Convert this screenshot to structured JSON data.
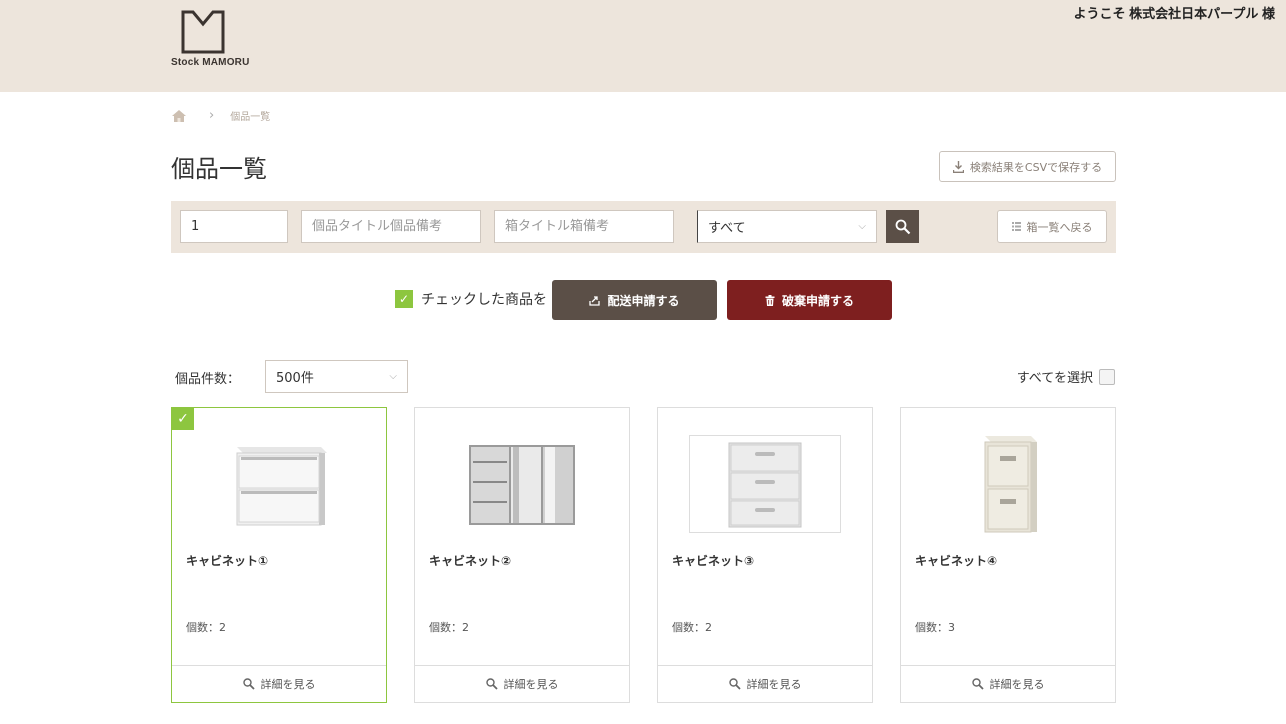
{
  "header": {
    "logo_text": "Stock MAMORU",
    "welcome": "ようこそ 株式会社日本パープル 様"
  },
  "breadcrumb": {
    "separator": "›",
    "current": "個品一覧"
  },
  "page": {
    "title": "個品一覧",
    "csv_button": "検索結果をCSVで保存する"
  },
  "search": {
    "box_number_value": "1",
    "item_placeholder": "個品タイトル個品備考",
    "box_placeholder": "箱タイトル箱備考",
    "category_selected": "すべて",
    "back_button": "箱一覧へ戻る"
  },
  "actions": {
    "checked_label": "チェックした商品を",
    "ship_button": "配送申請する",
    "dispose_button": "破棄申請する"
  },
  "listing": {
    "count_label": "個品件数：",
    "count_selected": "500件",
    "select_all_label": "すべてを選択"
  },
  "items": [
    {
      "name": "キャビネット①",
      "qty": "個数：2",
      "detail": "詳細を見る",
      "selected": true
    },
    {
      "name": "キャビネット②",
      "qty": "個数：2",
      "detail": "詳細を見る",
      "selected": false
    },
    {
      "name": "キャビネット③",
      "qty": "個数：2",
      "detail": "詳細を見る",
      "selected": false
    },
    {
      "name": "キャビネット④",
      "qty": "個数：3",
      "detail": "詳細を見る",
      "selected": false
    }
  ],
  "colors": {
    "header_bg": "#ede5dc",
    "primary_brown": "#5b4f47",
    "danger_red": "#7e1f1f",
    "check_green": "#8dc63f"
  }
}
